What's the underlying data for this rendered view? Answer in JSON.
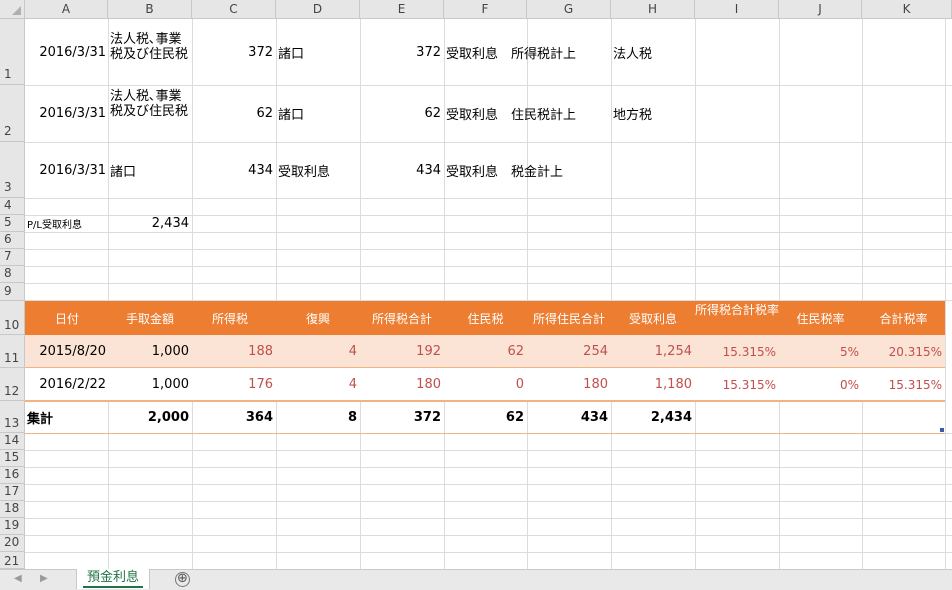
{
  "columns": [
    "A",
    "B",
    "C",
    "D",
    "E",
    "F",
    "G",
    "H",
    "I",
    "K"
  ],
  "column_J": "J",
  "rows": [
    "1",
    "2",
    "3",
    "4",
    "5",
    "6",
    "7",
    "8",
    "9",
    "10",
    "11",
    "12",
    "13",
    "14",
    "15",
    "16",
    "17",
    "18",
    "19",
    "20",
    "21"
  ],
  "journal": [
    {
      "date": "2016/3/31",
      "debit_account": "法人税､事業税及び住民税",
      "debit_amount": "372",
      "credit_account": "諸口",
      "credit_amount": "372",
      "memo1": "受取利息",
      "memo2": "所得税計上",
      "memo3": "法人税"
    },
    {
      "date": "2016/3/31",
      "debit_account": "法人税､事業税及び住民税",
      "debit_amount": "62",
      "credit_account": "諸口",
      "credit_amount": "62",
      "memo1": "受取利息",
      "memo2": "住民税計上",
      "memo3": "地方税"
    },
    {
      "date": "2016/3/31",
      "debit_account": "諸口",
      "debit_amount": "434",
      "credit_account": "受取利息",
      "credit_amount": "434",
      "memo1": "受取利息",
      "memo2": "税金計上",
      "memo3": ""
    }
  ],
  "pl_label": "P/L受取利息",
  "pl_value": "2,434",
  "table": {
    "headers": [
      "日付",
      "手取金額",
      "所得税",
      "復興",
      "所得税合計",
      "住民税",
      "所得住民合計",
      "受取利息",
      "所得税合計税率",
      "住民税率",
      "合計税率"
    ],
    "rows": [
      [
        "2015/8/20",
        "1,000",
        "188",
        "4",
        "192",
        "62",
        "254",
        "1,254",
        "15.315%",
        "5%",
        "20.315%"
      ],
      [
        "2016/2/22",
        "1,000",
        "176",
        "4",
        "180",
        "0",
        "180",
        "1,180",
        "15.315%",
        "0%",
        "15.315%"
      ]
    ],
    "total": [
      "集計",
      "2,000",
      "364",
      "8",
      "372",
      "62",
      "434",
      "2,434"
    ]
  },
  "sheet_tab": "預金利息",
  "add_sheet": "⊕",
  "nav_prev": "◀",
  "nav_next": "▶",
  "colors": {
    "header_orange": "#ed7d31",
    "band_light": "#fbe4d5",
    "value_red": "#c0504d",
    "tab_green": "#217346"
  }
}
